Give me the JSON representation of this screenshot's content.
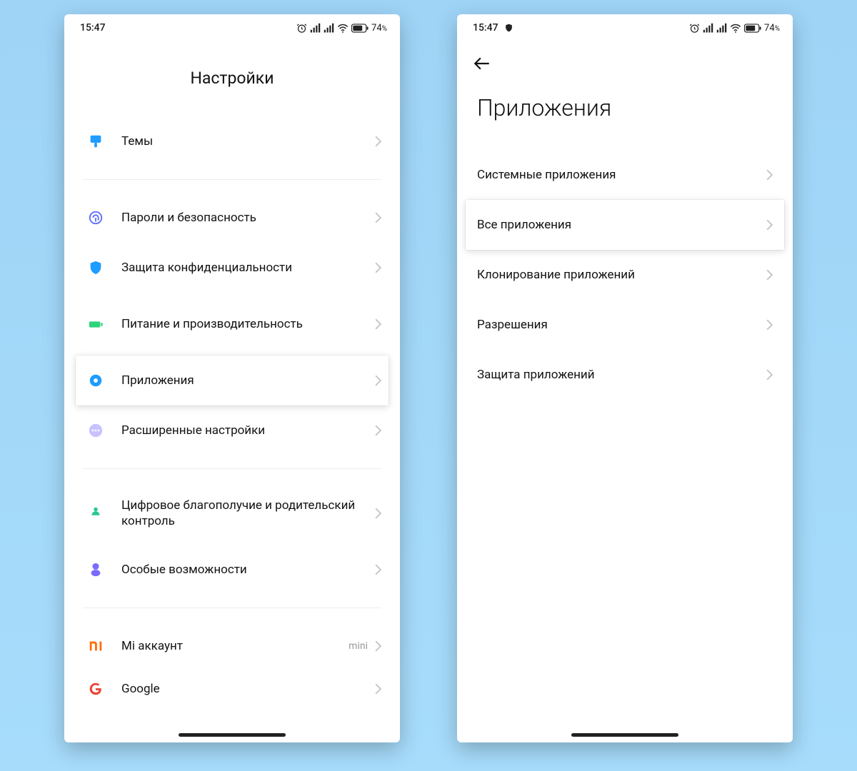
{
  "status": {
    "time": "15:47",
    "battery_pct": "74",
    "battery_suffix": "%"
  },
  "left": {
    "title": "Настройки",
    "items": {
      "themes": "Темы",
      "passwords": "Пароли и безопасность",
      "privacy": "Защита конфиденциальности",
      "power": "Питание и производительность",
      "apps": "Приложения",
      "advanced": "Расширенные настройки",
      "wellbeing": "Цифровое благополучие и родительский контроль",
      "accessibility": "Особые возможности",
      "mi_account": "Mi аккаунт",
      "mi_account_meta": "mini",
      "google": "Google"
    }
  },
  "right": {
    "title": "Приложения",
    "items": {
      "system_apps": "Системные приложения",
      "all_apps": "Все приложения",
      "cloning": "Клонирование приложений",
      "permissions": "Разрешения",
      "app_protection": "Защита приложений"
    }
  }
}
